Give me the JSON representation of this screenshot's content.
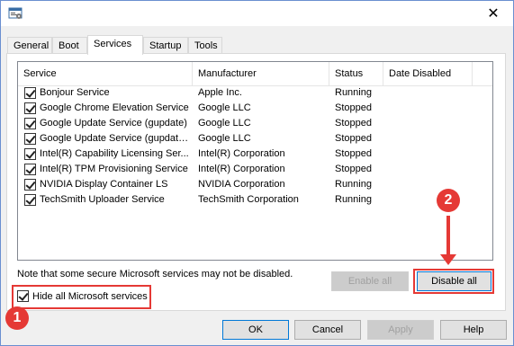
{
  "window": {
    "close_glyph": "✕"
  },
  "tabs": [
    "General",
    "Boot",
    "Services",
    "Startup",
    "Tools"
  ],
  "list": {
    "columns": [
      "Service",
      "Manufacturer",
      "Status",
      "Date Disabled"
    ],
    "rows": [
      {
        "checked": true,
        "service": "Bonjour Service",
        "manufacturer": "Apple Inc.",
        "status": "Running"
      },
      {
        "checked": true,
        "service": "Google Chrome Elevation Service",
        "manufacturer": "Google LLC",
        "status": "Stopped"
      },
      {
        "checked": true,
        "service": "Google Update Service (gupdate)",
        "manufacturer": "Google LLC",
        "status": "Stopped"
      },
      {
        "checked": true,
        "service": "Google Update Service (gupdatem)",
        "manufacturer": "Google LLC",
        "status": "Stopped"
      },
      {
        "checked": true,
        "service": "Intel(R) Capability Licensing Ser...",
        "manufacturer": "Intel(R) Corporation",
        "status": "Stopped"
      },
      {
        "checked": true,
        "service": "Intel(R) TPM Provisioning Service",
        "manufacturer": "Intel(R) Corporation",
        "status": "Stopped"
      },
      {
        "checked": true,
        "service": "NVIDIA Display Container LS",
        "manufacturer": "NVIDIA Corporation",
        "status": "Running"
      },
      {
        "checked": true,
        "service": "TechSmith Uploader Service",
        "manufacturer": "TechSmith Corporation",
        "status": "Running"
      }
    ]
  },
  "note": "Note that some secure Microsoft services may not be disabled.",
  "buttons": {
    "enable_all": "Enable all",
    "disable_all": "Disable all",
    "ok": "OK",
    "cancel": "Cancel",
    "apply": "Apply",
    "help": "Help"
  },
  "hide_ms": {
    "label": "Hide all Microsoft services",
    "checked": true
  },
  "annotations": {
    "badge1": "1",
    "badge2": "2",
    "color": "#e53935"
  }
}
